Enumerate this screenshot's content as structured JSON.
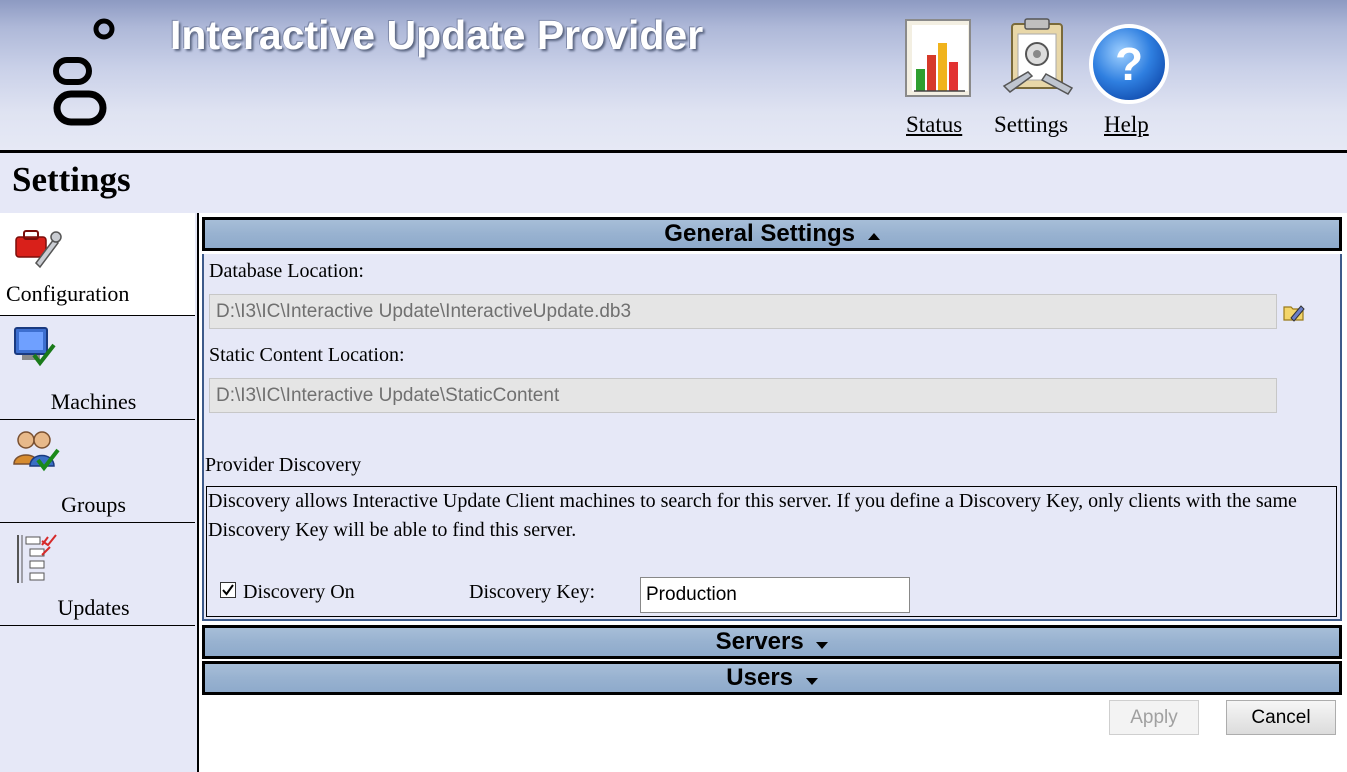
{
  "header": {
    "title": "Interactive Update Provider",
    "nav": [
      {
        "label": "Status",
        "icon": "status-chart-icon",
        "underlined": true
      },
      {
        "label": "Settings",
        "icon": "settings-clipboard-icon",
        "underlined": false
      },
      {
        "label": "Help",
        "icon": "help-icon",
        "underlined": true
      }
    ]
  },
  "page": {
    "title": "Settings"
  },
  "sidebar": {
    "items": [
      {
        "label": "Configuration",
        "icon": "toolbox-wrench-icon",
        "active": true
      },
      {
        "label": "Machines",
        "icon": "computer-check-icon",
        "active": false
      },
      {
        "label": "Groups",
        "icon": "users-check-icon",
        "active": false
      },
      {
        "label": "Updates",
        "icon": "tree-list-icon",
        "active": false
      }
    ]
  },
  "general": {
    "header": "General Settings",
    "expanded": true,
    "database_location_label": "Database Location:",
    "database_location_value": "D:\\I3\\IC\\Interactive Update\\InteractiveUpdate.db3",
    "static_content_label": "Static Content Location:",
    "static_content_value": "D:\\I3\\IC\\Interactive Update\\StaticContent",
    "provider_discovery_label": "Provider Discovery",
    "discovery_description": "Discovery allows Interactive Update Client machines to search for this server. If you define a Discovery Key, only clients with the same Discovery Key will be able to find this server.",
    "discovery_on_label": "Discovery On",
    "discovery_on_checked": true,
    "discovery_key_label": "Discovery Key:",
    "discovery_key_value": "Production"
  },
  "sections": {
    "servers": {
      "header": "Servers",
      "expanded": false
    },
    "users": {
      "header": "Users",
      "expanded": false
    }
  },
  "buttons": {
    "apply": "Apply",
    "apply_enabled": false,
    "cancel": "Cancel"
  },
  "colors": {
    "section_header": "#98b2d0",
    "panel_background": "#e6e8f7",
    "title_text": "#ffffff"
  }
}
